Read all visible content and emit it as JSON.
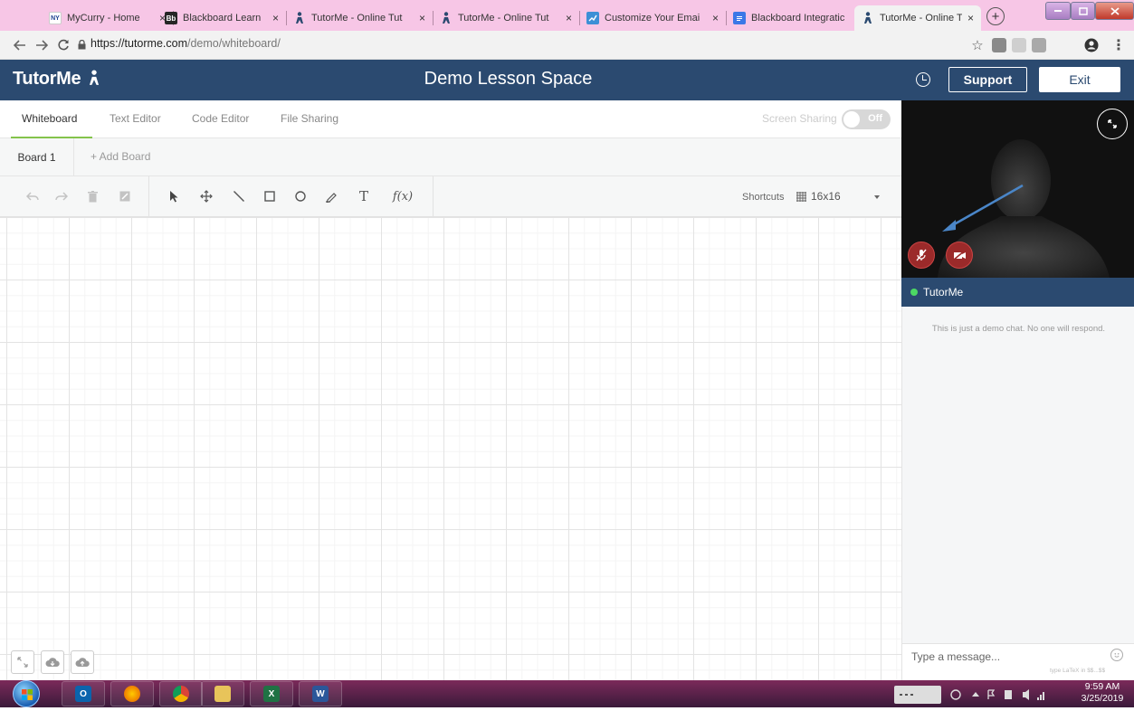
{
  "browser": {
    "tabs": [
      {
        "favicon": "NY",
        "favicon_color": "#1b3f8f",
        "title": "MyCurry - Home"
      },
      {
        "favicon": "Bb",
        "favicon_color": "#262626",
        "title": "Blackboard Learn"
      },
      {
        "favicon": "tutorme-icon",
        "favicon_color": "#2b4a70",
        "title": "TutorMe - Online Tut"
      },
      {
        "favicon": "tutorme-icon",
        "favicon_color": "#2b4a70",
        "title": "TutorMe - Online Tut"
      },
      {
        "favicon": "chart",
        "favicon_color": "#3d8fd6",
        "title": "Customize Your Emai"
      },
      {
        "favicon": "doc",
        "favicon_color": "#3b78e7",
        "title": "Blackboard Integratic"
      },
      {
        "favicon": "tutorme-icon",
        "favicon_color": "#2b4a70",
        "title": "TutorMe - Online Tut"
      }
    ],
    "close_glyph": "×",
    "new_tab_glyph": "+",
    "url_host": "https://tutorme.com",
    "url_path": "/demo/whiteboard/",
    "star": "☆",
    "menu": "⋮"
  },
  "app": {
    "logo": "TutorMe",
    "title": "Demo Lesson Space",
    "support_label": "Support",
    "exit_label": "Exit"
  },
  "workspace": {
    "mode_tabs": [
      "Whiteboard",
      "Text Editor",
      "Code Editor",
      "File Sharing"
    ],
    "screen_sharing_label": "Screen Sharing",
    "screen_sharing_state": "Off",
    "board_tab": "Board 1",
    "add_board": "+ Add Board",
    "shortcuts_label": "Shortcuts",
    "grid_size": "16x16",
    "text_tool": "T",
    "function_tool": "f(x)"
  },
  "chat": {
    "partner_name": "TutorMe",
    "status_color": "#4cd964",
    "demo_note": "This is just a demo chat. No one will respond.",
    "input_placeholder": "Type a message...",
    "latex_hint": "type LaTeX in $$...$$"
  },
  "taskbar": {
    "time": "9:59 AM",
    "date": "3/25/2019"
  }
}
